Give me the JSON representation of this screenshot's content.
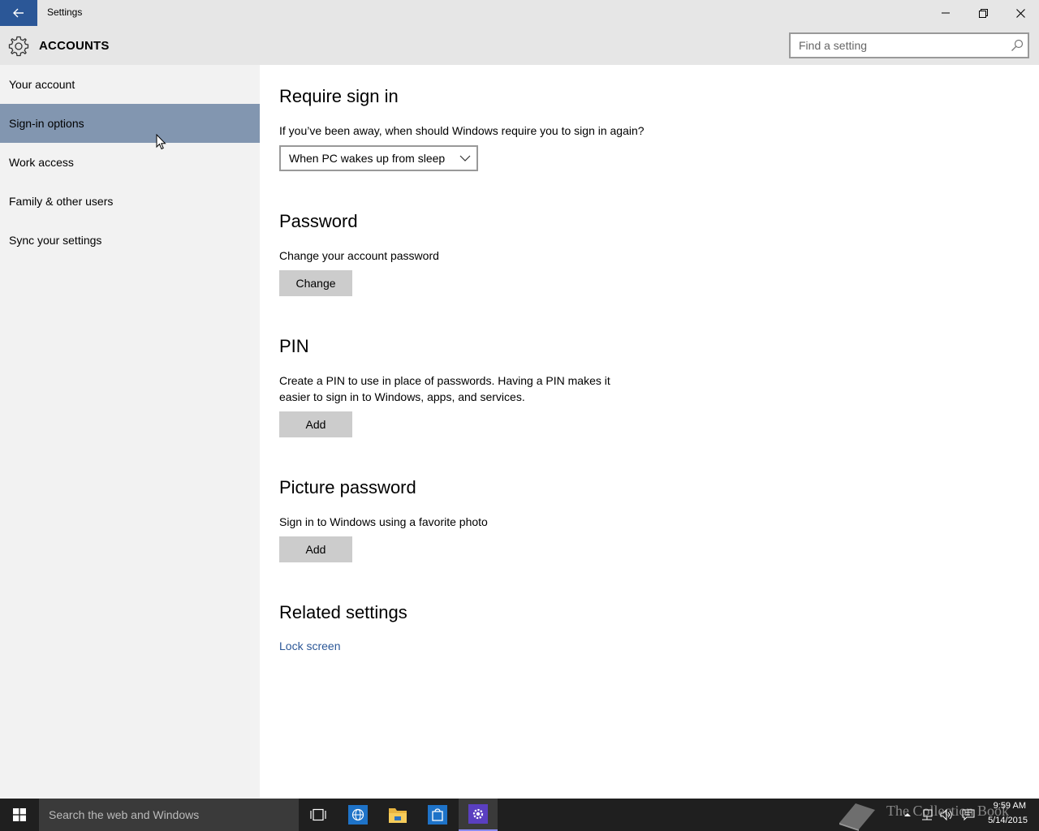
{
  "window": {
    "title": "Settings"
  },
  "header": {
    "section_title": "ACCOUNTS",
    "search_placeholder": "Find a setting"
  },
  "sidebar": {
    "items": [
      {
        "label": "Your account",
        "selected": false
      },
      {
        "label": "Sign-in options",
        "selected": true
      },
      {
        "label": "Work access",
        "selected": false
      },
      {
        "label": "Family & other users",
        "selected": false
      },
      {
        "label": "Sync your settings",
        "selected": false
      }
    ]
  },
  "content": {
    "require_sign_in": {
      "heading": "Require sign in",
      "description": "If you’ve been away, when should Windows require you to sign in again?",
      "dropdown_value": "When PC wakes up from sleep"
    },
    "password": {
      "heading": "Password",
      "description": "Change your account password",
      "button": "Change"
    },
    "pin": {
      "heading": "PIN",
      "description_line1": "Create a PIN to use in place of passwords. Having a PIN makes it",
      "description_line2": "easier to sign in to Windows, apps, and services.",
      "button": "Add"
    },
    "picture_password": {
      "heading": "Picture password",
      "description": "Sign in to Windows using a favorite photo",
      "button": "Add"
    },
    "related": {
      "heading": "Related settings",
      "link": "Lock screen"
    }
  },
  "taskbar": {
    "search_text": "Search the web and Windows",
    "watermark": "The Collection Book",
    "time": "9:59 AM",
    "date": "5/14/2015"
  },
  "colors": {
    "accent": "#2b5797",
    "selected_nav": "#8296b0",
    "button": "#cccccc",
    "titlebar": "#e6e6e6",
    "sidebar": "#f2f2f2",
    "taskbar": "#1f1f1f"
  }
}
